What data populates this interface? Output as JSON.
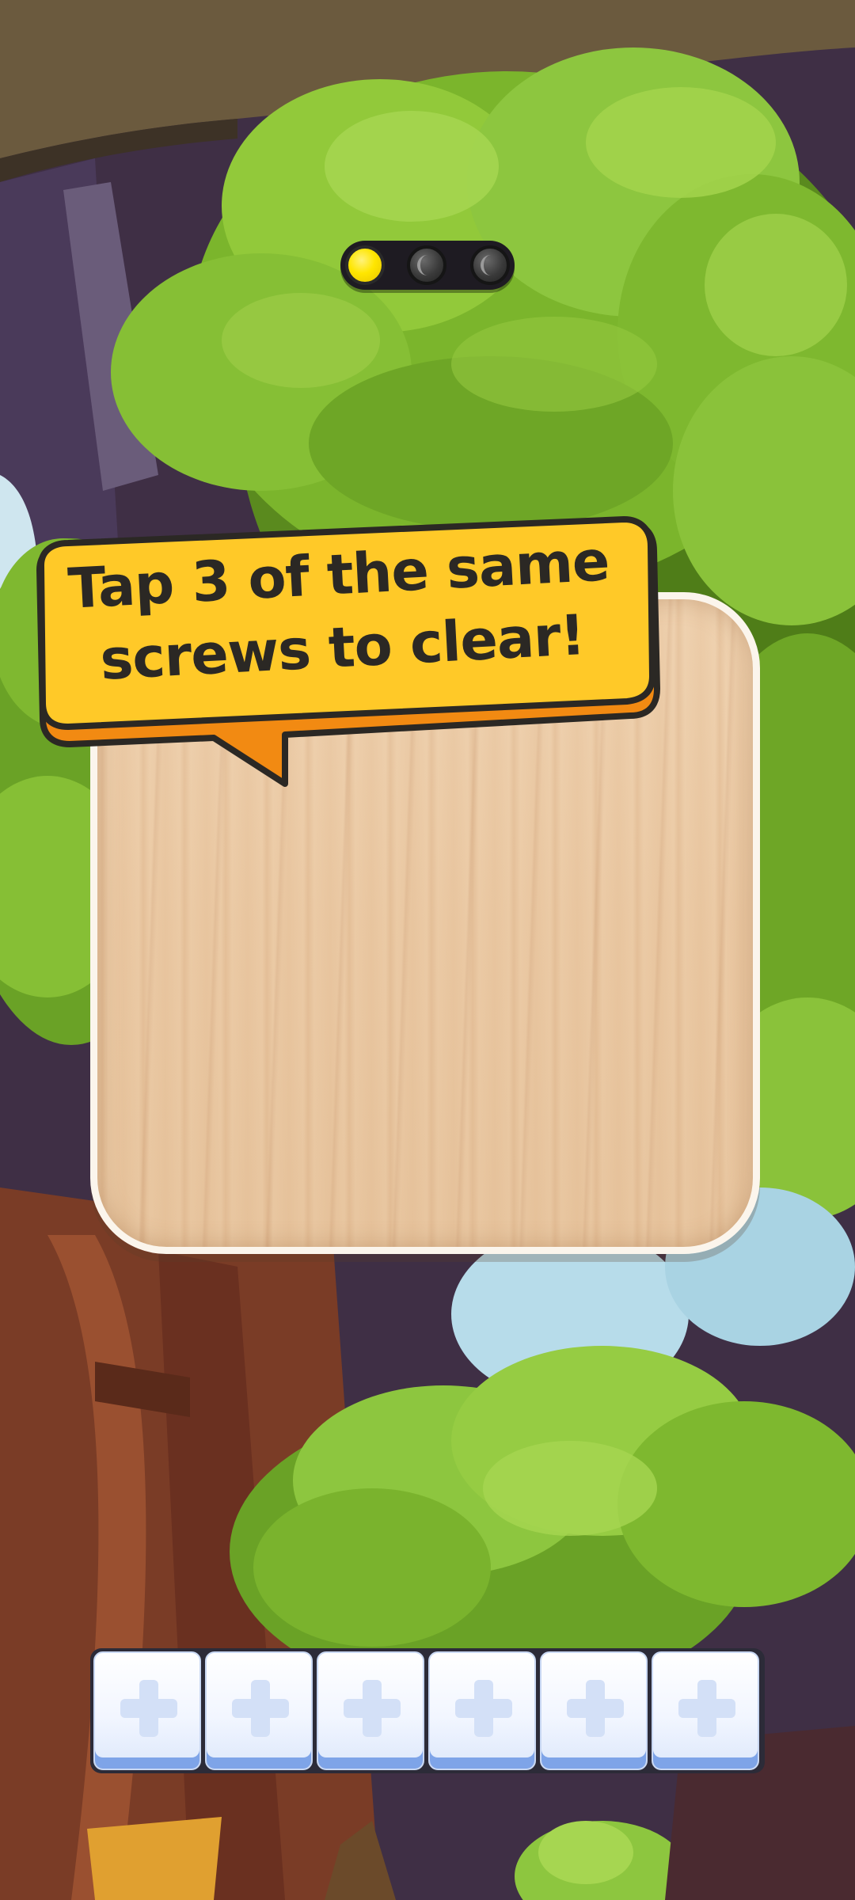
{
  "game": {
    "tutorial_text": "Tap 3 of the same screws to clear!",
    "progress_steps": [
      {
        "state": "active",
        "icon": "screw-head-yellow-icon"
      },
      {
        "state": "inactive",
        "icon": "screw-head-dark-icon"
      },
      {
        "state": "inactive",
        "icon": "screw-head-dark-icon"
      }
    ],
    "slots": [
      {
        "icon": "plus-icon"
      },
      {
        "icon": "plus-icon"
      },
      {
        "icon": "plus-icon"
      },
      {
        "icon": "plus-icon"
      },
      {
        "icon": "plus-icon"
      },
      {
        "icon": "plus-icon"
      }
    ]
  },
  "colors": {
    "bubble_yellow": "#ffc928",
    "bubble_orange": "#f28a12",
    "text_dark": "#2b2824",
    "active_dot": "#ffe600",
    "slot_accent": "#7ea4e8",
    "foliage": "#8dc63f"
  }
}
